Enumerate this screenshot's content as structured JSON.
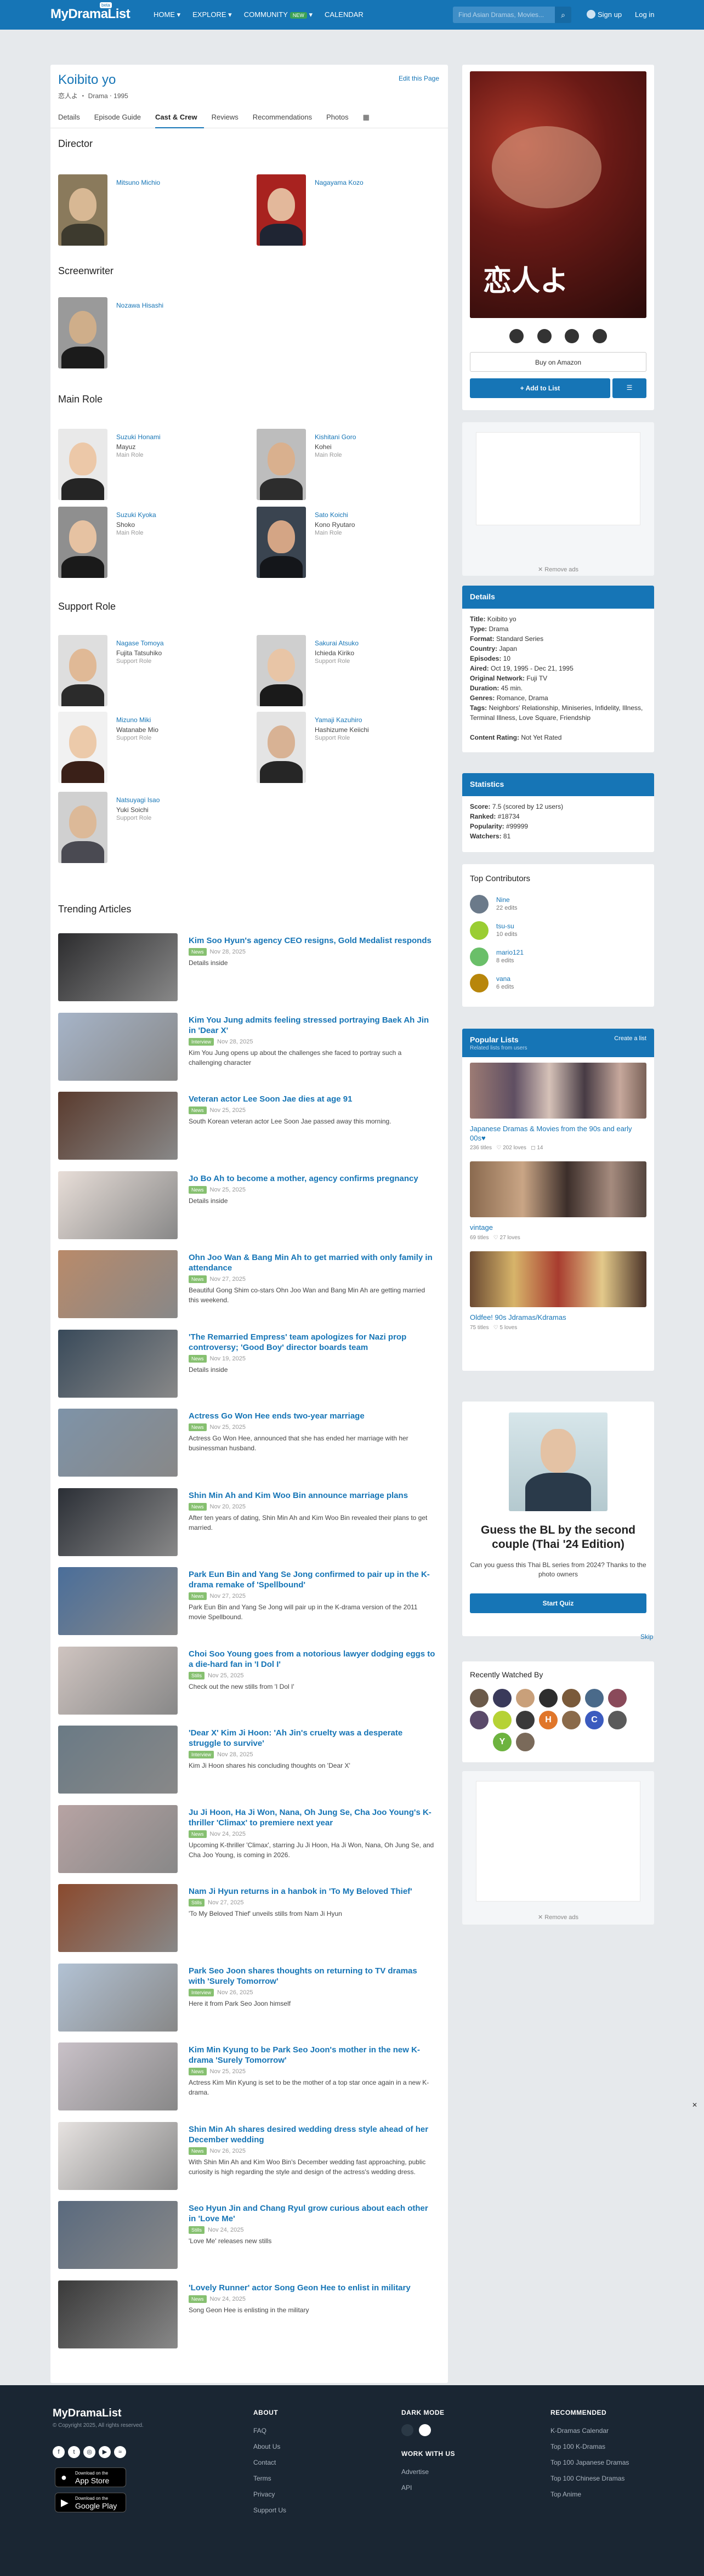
{
  "header": {
    "logo": "MyDramaList",
    "logo_badge": "beta",
    "nav": [
      "HOME",
      "EXPLORE",
      "COMMUNITY",
      "CALENDAR"
    ],
    "new_badge": "NEW",
    "search_placeholder": "Find Asian Dramas, Movies...",
    "signup": "Sign up",
    "login": "Log in"
  },
  "drama": {
    "title": "Koibito yo",
    "subtitle": "恋人よ ‧ Drama ‧ 1995",
    "edit": "Edit this Page"
  },
  "tabs": [
    "Details",
    "Episode Guide",
    "Cast & Crew",
    "Reviews",
    "Recommendations",
    "Photos"
  ],
  "sections": {
    "director": "Director",
    "screenwriter": "Screenwriter",
    "main": "Main Role",
    "support": "Support Role",
    "trending": "Trending Articles"
  },
  "director": [
    {
      "name": "Mitsuno Michio"
    },
    {
      "name": "Nagayama Kozo"
    }
  ],
  "screenwriter": [
    {
      "name": "Nozawa Hisashi"
    }
  ],
  "main_role": [
    {
      "name": "Suzuki Honami",
      "char": "Mayuz",
      "role": "Main Role"
    },
    {
      "name": "Kishitani Goro",
      "char": "Kohei",
      "role": "Main Role"
    },
    {
      "name": "Suzuki Kyoka",
      "char": "Shoko",
      "role": "Main Role"
    },
    {
      "name": "Sato Koichi",
      "char": "Kono Ryutaro",
      "role": "Main Role"
    }
  ],
  "support_role": [
    {
      "name": "Nagase Tomoya",
      "char": "Fujita Tatsuhiko",
      "role": "Support Role"
    },
    {
      "name": "Sakurai Atsuko",
      "char": "Ichieda Kiriko",
      "role": "Support Role"
    },
    {
      "name": "Mizuno Miki",
      "char": "Watanabe Mio",
      "role": "Support Role"
    },
    {
      "name": "Yamaji Kazuhiro",
      "char": "Hashizume Keiichi",
      "role": "Support Role"
    },
    {
      "name": "Natsuyagi Isao",
      "char": "Yuki Soichi",
      "role": "Support Role"
    }
  ],
  "articles": [
    {
      "title": "Kim Soo Hyun's agency CEO resigns, Gold Medalist responds",
      "tag": "News",
      "date": "Nov 28, 2025",
      "excerpt": "Details inside"
    },
    {
      "title": "Kim You Jung admits feeling stressed portraying Baek Ah Jin in 'Dear X'",
      "tag": "Interview",
      "date": "Nov 28, 2025",
      "excerpt": "Kim You Jung opens up about the challenges she faced to portray such a challenging character"
    },
    {
      "title": "Veteran actor Lee Soon Jae dies at age 91",
      "tag": "News",
      "date": "Nov 25, 2025",
      "excerpt": "South Korean veteran actor Lee Soon Jae passed away this morning."
    },
    {
      "title": "Jo Bo Ah to become a mother, agency confirms pregnancy",
      "tag": "News",
      "date": "Nov 25, 2025",
      "excerpt": "Details inside"
    },
    {
      "title": "Ohn Joo Wan & Bang Min Ah to get married with only family in attendance",
      "tag": "News",
      "date": "Nov 27, 2025",
      "excerpt": "Beautiful Gong Shim co-stars Ohn Joo Wan and Bang Min Ah are getting married this weekend."
    },
    {
      "title": "'The Remarried Empress' team apologizes for Nazi prop controversy; 'Good Boy' director boards team",
      "tag": "News",
      "date": "Nov 19, 2025",
      "excerpt": "Details inside"
    },
    {
      "title": "Actress Go Won Hee ends two-year marriage",
      "tag": "News",
      "date": "Nov 25, 2025",
      "excerpt": "Actress Go Won Hee, announced that she has ended her marriage with her businessman husband."
    },
    {
      "title": "Shin Min Ah and Kim Woo Bin announce marriage plans",
      "tag": "News",
      "date": "Nov 20, 2025",
      "excerpt": "After ten years of dating, Shin Min Ah and Kim Woo Bin revealed their plans to get married."
    },
    {
      "title": "Park Eun Bin and Yang Se Jong confirmed to pair up in the K-drama remake of 'Spellbound'",
      "tag": "News",
      "date": "Nov 27, 2025",
      "excerpt": "Park Eun Bin and Yang Se Jong will pair up in the K-drama version of the 2011 movie Spellbound."
    },
    {
      "title": "Choi Soo Young goes from a notorious lawyer dodging eggs to a die-hard fan in 'I Dol I'",
      "tag": "Stills",
      "date": "Nov 25, 2025",
      "excerpt": "Check out the new stills from 'I Dol I'"
    },
    {
      "title": "'Dear X' Kim Ji Hoon: 'Ah Jin's cruelty was a desperate struggle to survive'",
      "tag": "Interview",
      "date": "Nov 28, 2025",
      "excerpt": "Kim Ji Hoon shares his concluding thoughts on 'Dear X'"
    },
    {
      "title": "Ju Ji Hoon, Ha Ji Won, Nana, Oh Jung Se, Cha Joo Young's K-thriller 'Climax' to premiere next year",
      "tag": "News",
      "date": "Nov 24, 2025",
      "excerpt": "Upcoming K-thriller 'Climax', starring Ju Ji Hoon, Ha Ji Won, Nana, Oh Jung Se, and Cha Joo Young, is coming in 2026."
    },
    {
      "title": "Nam Ji Hyun returns in a hanbok in 'To My Beloved Thief'",
      "tag": "Stills",
      "date": "Nov 27, 2025",
      "excerpt": "'To My Beloved Thief' unveils stills from Nam Ji Hyun"
    },
    {
      "title": "Park Seo Joon shares thoughts on returning to TV dramas with 'Surely Tomorrow'",
      "tag": "Interview",
      "date": "Nov 26, 2025",
      "excerpt": "Here it from Park Seo Joon himself"
    },
    {
      "title": "Kim Min Kyung to be Park Seo Joon's mother in the new K-drama 'Surely Tomorrow'",
      "tag": "News",
      "date": "Nov 25, 2025",
      "excerpt": "Actress Kim Min Kyung is set to be the mother of a top star once again in a new K-drama."
    },
    {
      "title": "Shin Min Ah shares desired wedding dress style ahead of her December wedding",
      "tag": "News",
      "date": "Nov 26, 2025",
      "excerpt": "With Shin Min Ah and Kim Woo Bin's December wedding fast approaching, public curiosity is high regarding the style and design of the actress's wedding dress."
    },
    {
      "title": "Seo Hyun Jin and Chang Ryul grow curious about each other in 'Love Me'",
      "tag": "Stills",
      "date": "Nov 24, 2025",
      "excerpt": "'Love Me' releases new stills"
    },
    {
      "title": "'Lovely Runner' actor Song Geon Hee to enlist in military",
      "tag": "News",
      "date": "Nov 24, 2025",
      "excerpt": "Song Geon Hee is enlisting in the military"
    }
  ],
  "poster": {
    "title_jp": "恋人よ",
    "buy": "Buy on Amazon",
    "add": "+ Add to List"
  },
  "remove_ads": "✕ Remove ads",
  "details": {
    "header": "Details",
    "rows": [
      {
        "k": "Title:",
        "v": "Koibito yo"
      },
      {
        "k": "Type:",
        "v": "Drama"
      },
      {
        "k": "Format:",
        "v": "Standard Series"
      },
      {
        "k": "Country:",
        "v": "Japan"
      },
      {
        "k": "Episodes:",
        "v": "10"
      },
      {
        "k": "Aired:",
        "v": "Oct 19, 1995 - Dec 21, 1995"
      },
      {
        "k": "Original Network:",
        "v": "Fuji TV"
      },
      {
        "k": "Duration:",
        "v": "45 min."
      },
      {
        "k": "Genres:",
        "v": "Romance, Drama"
      },
      {
        "k": "Tags:",
        "v": "Neighbors' Relationship, Miniseries, Infidelity, Illness, Terminal Illness, Love Square, Friendship"
      },
      {
        "k": "Content Rating:",
        "v": "Not Yet Rated"
      }
    ]
  },
  "stats": {
    "header": "Statistics",
    "rows": [
      {
        "k": "Score:",
        "v": "7.5 (scored by 12 users)"
      },
      {
        "k": "Ranked:",
        "v": "#18734"
      },
      {
        "k": "Popularity:",
        "v": "#99999"
      },
      {
        "k": "Watchers:",
        "v": "81"
      }
    ]
  },
  "contributors": {
    "header": "Top Contributors",
    "items": [
      {
        "name": "Nine",
        "edits": "22 edits",
        "color": "#6b7a8a"
      },
      {
        "name": "tsu-su",
        "edits": "10 edits",
        "color": "#9acd32"
      },
      {
        "name": "mario121",
        "edits": "8 edits",
        "color": "#6abf69"
      },
      {
        "name": "vana",
        "edits": "6 edits",
        "color": "#b8860b"
      }
    ]
  },
  "popular": {
    "header": "Popular Lists",
    "sub": "Related lists from users",
    "create": "Create a list",
    "items": [
      {
        "title": "Japanese Dramas & Movies from the 90s and early 00s♥",
        "views": "236 titles",
        "loves": "202 loves",
        "comments": "14"
      },
      {
        "title": "vintage",
        "views": "69 titles",
        "loves": "27 loves",
        "comments": ""
      },
      {
        "title": "Oldfee! 90s Jdramas/Kdramas",
        "views": "75 titles",
        "loves": "5 loves",
        "comments": ""
      }
    ]
  },
  "quiz": {
    "title": "Guess the BL by the second couple (Thai '24 Edition)",
    "desc": "Can you guess this Thai BL series from 2024? Thanks to the photo owners",
    "btn": "Start Quiz",
    "skip": "Skip"
  },
  "recent": {
    "header": "Recently Watched By"
  },
  "footer": {
    "logo": "MyDramaList",
    "copy": "© Copyright 2025, All rights reserved.",
    "appstore_a": "Download on the",
    "appstore_b": "App Store",
    "gplay_a": "Download on the",
    "gplay_b": "Google Play",
    "about_h": "ABOUT",
    "about": [
      "FAQ",
      "About Us",
      "Contact",
      "Terms",
      "Privacy",
      "Support Us"
    ],
    "dark_h": "DARK MODE",
    "work_h": "WORK WITH US",
    "work": [
      "Advertise",
      "API"
    ],
    "rec_h": "RECOMMENDED",
    "rec": [
      "K-Dramas Calendar",
      "Top 100 K-Dramas",
      "Top 100 Japanese Dramas",
      "Top 100 Chinese Dramas",
      "Top Anime"
    ]
  }
}
